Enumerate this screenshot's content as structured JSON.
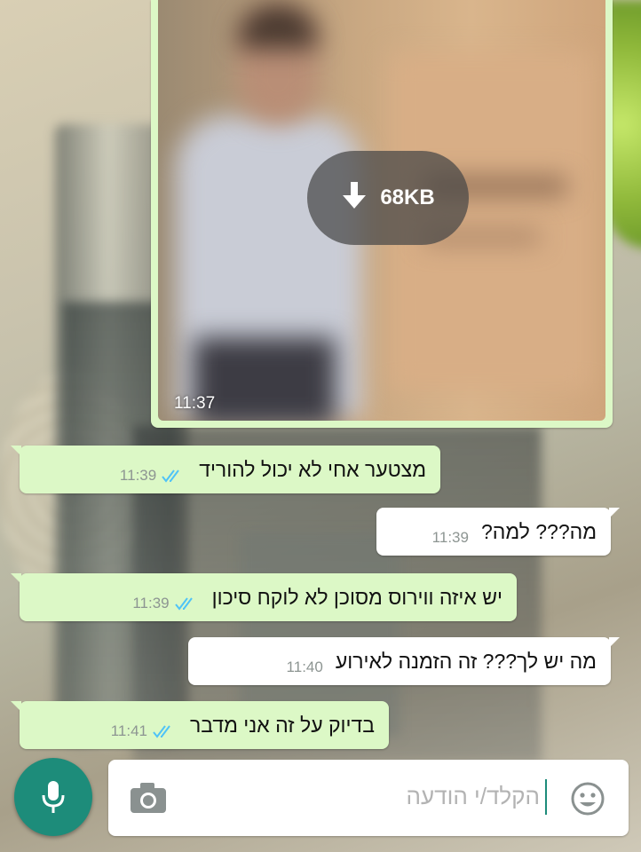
{
  "image_message": {
    "download_size": "68KB",
    "time": "11:37"
  },
  "messages": [
    {
      "direction": "out",
      "text": "מצטער אחי לא יכול להוריד",
      "time": "11:39",
      "status": "read"
    },
    {
      "direction": "in",
      "text": "מה??? למה?",
      "time": "11:39"
    },
    {
      "direction": "out",
      "text": "יש איזה ווירוס מסוכן לא לוקח סיכון",
      "time": "11:39",
      "status": "read"
    },
    {
      "direction": "in",
      "text": "מה יש לך??? זה הזמנה לאירוע",
      "time": "11:40"
    },
    {
      "direction": "out",
      "text": "בדיוק על זה  אני מדבר",
      "time": "11:41",
      "status": "read"
    }
  ],
  "composer": {
    "placeholder": "הקלד/י הודעה"
  },
  "icons": {
    "download": "download-arrow-icon",
    "read_ticks": "double-check-icon",
    "mic": "microphone-icon",
    "camera": "camera-icon",
    "emoji": "smiley-icon"
  },
  "colors": {
    "outgoing_bubble": "#dcf8c6",
    "incoming_bubble": "#ffffff",
    "accent": "#1d8c7a",
    "read_ticks": "#4fc3f7"
  }
}
